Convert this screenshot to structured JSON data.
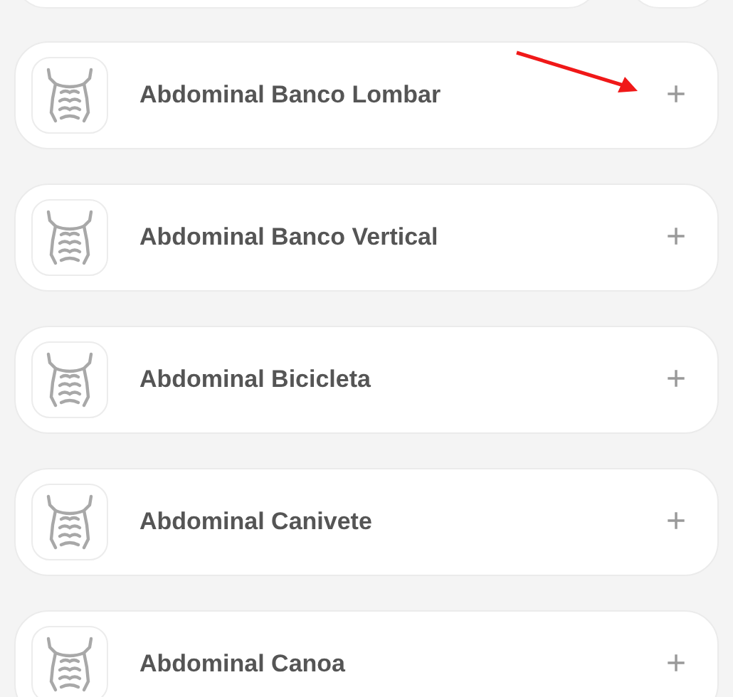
{
  "exercises": [
    {
      "name": "Abdominal Banco Lombar",
      "add": "+"
    },
    {
      "name": "Abdominal Banco Vertical",
      "add": "+"
    },
    {
      "name": "Abdominal Bicicleta",
      "add": "+"
    },
    {
      "name": "Abdominal Canivete",
      "add": "+"
    },
    {
      "name": "Abdominal Canoa",
      "add": "+"
    }
  ]
}
